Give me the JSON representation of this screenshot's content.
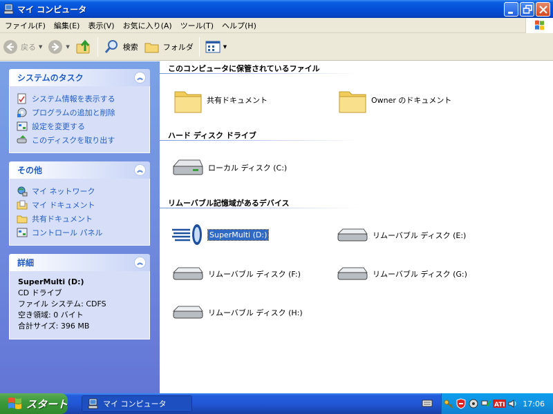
{
  "window": {
    "title": "マイ コンピュータ"
  },
  "menu": [
    "ファイル(F)",
    "編集(E)",
    "表示(V)",
    "お気に入り(A)",
    "ツール(T)",
    "ヘルプ(H)"
  ],
  "toolbar": {
    "back": "戻る",
    "search": "検索",
    "folders": "フォルダ"
  },
  "left": {
    "system_tasks": {
      "title": "システムのタスク",
      "items": [
        "システム情報を表示する",
        "プログラムの追加と削除",
        "設定を変更する",
        "このディスクを取り出す"
      ]
    },
    "other": {
      "title": "その他",
      "items": [
        "マイ ネットワーク",
        "マイ ドキュメント",
        "共有ドキュメント",
        "コントロール パネル"
      ]
    },
    "details": {
      "title": "詳細",
      "name": "SuperMulti (D:)",
      "type": "CD ドライブ",
      "filesystem": "ファイル システム: CDFS",
      "free": "空き領域: 0 バイト",
      "total": "合計サイズ: 396 MB"
    }
  },
  "main": {
    "files_section": {
      "title": "このコンピュータに保管されているファイル",
      "items": [
        "共有ドキュメント",
        "Owner のドキュメント"
      ]
    },
    "hdd_section": {
      "title": "ハード ディスク ドライブ",
      "items": [
        "ローカル ディスク (C:)"
      ]
    },
    "removable_section": {
      "title": "リムーバブル記憶域があるデバイス",
      "items": [
        "SuperMulti (D:)",
        "リムーバブル ディスク (E:)",
        "リムーバブル ディスク (F:)",
        "リムーバブル ディスク (G:)",
        "リムーバブル ディスク (H:)"
      ]
    }
  },
  "taskbar": {
    "start": "スタート",
    "task": "マイ コンピュータ",
    "clock": "17:06"
  }
}
